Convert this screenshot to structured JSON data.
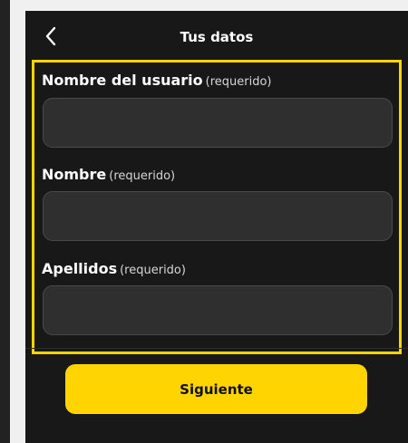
{
  "header": {
    "title": "Tus datos",
    "back_icon": "chevron-left-icon"
  },
  "form": {
    "fields": [
      {
        "label": "Nombre del usuario",
        "hint": "(requerido)",
        "value": "",
        "placeholder": ""
      },
      {
        "label": "Nombre",
        "hint": "(requerido)",
        "value": "",
        "placeholder": ""
      },
      {
        "label": "Apellidos",
        "hint": "(requerido)",
        "value": "",
        "placeholder": ""
      }
    ],
    "highlight_color": "#ffd400"
  },
  "footer": {
    "next_label": "Siguiente"
  },
  "colors": {
    "background": "#181818",
    "field_bg": "#2f2f2f",
    "accent": "#ffd400"
  }
}
